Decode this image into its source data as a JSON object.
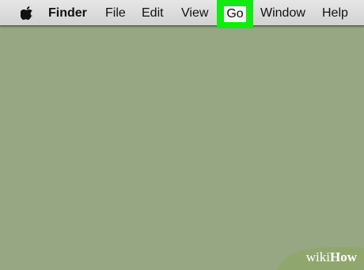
{
  "menubar": {
    "apple_icon": "apple-logo-icon",
    "app_name": "Finder",
    "items": [
      "File",
      "Edit",
      "View",
      "Go",
      "Window",
      "Help"
    ],
    "highlighted_item": "Go",
    "highlight_color": "#12ea12"
  },
  "desktop": {
    "background_color": "#97a784"
  },
  "watermark": {
    "wiki": "wiki",
    "how": "How"
  }
}
